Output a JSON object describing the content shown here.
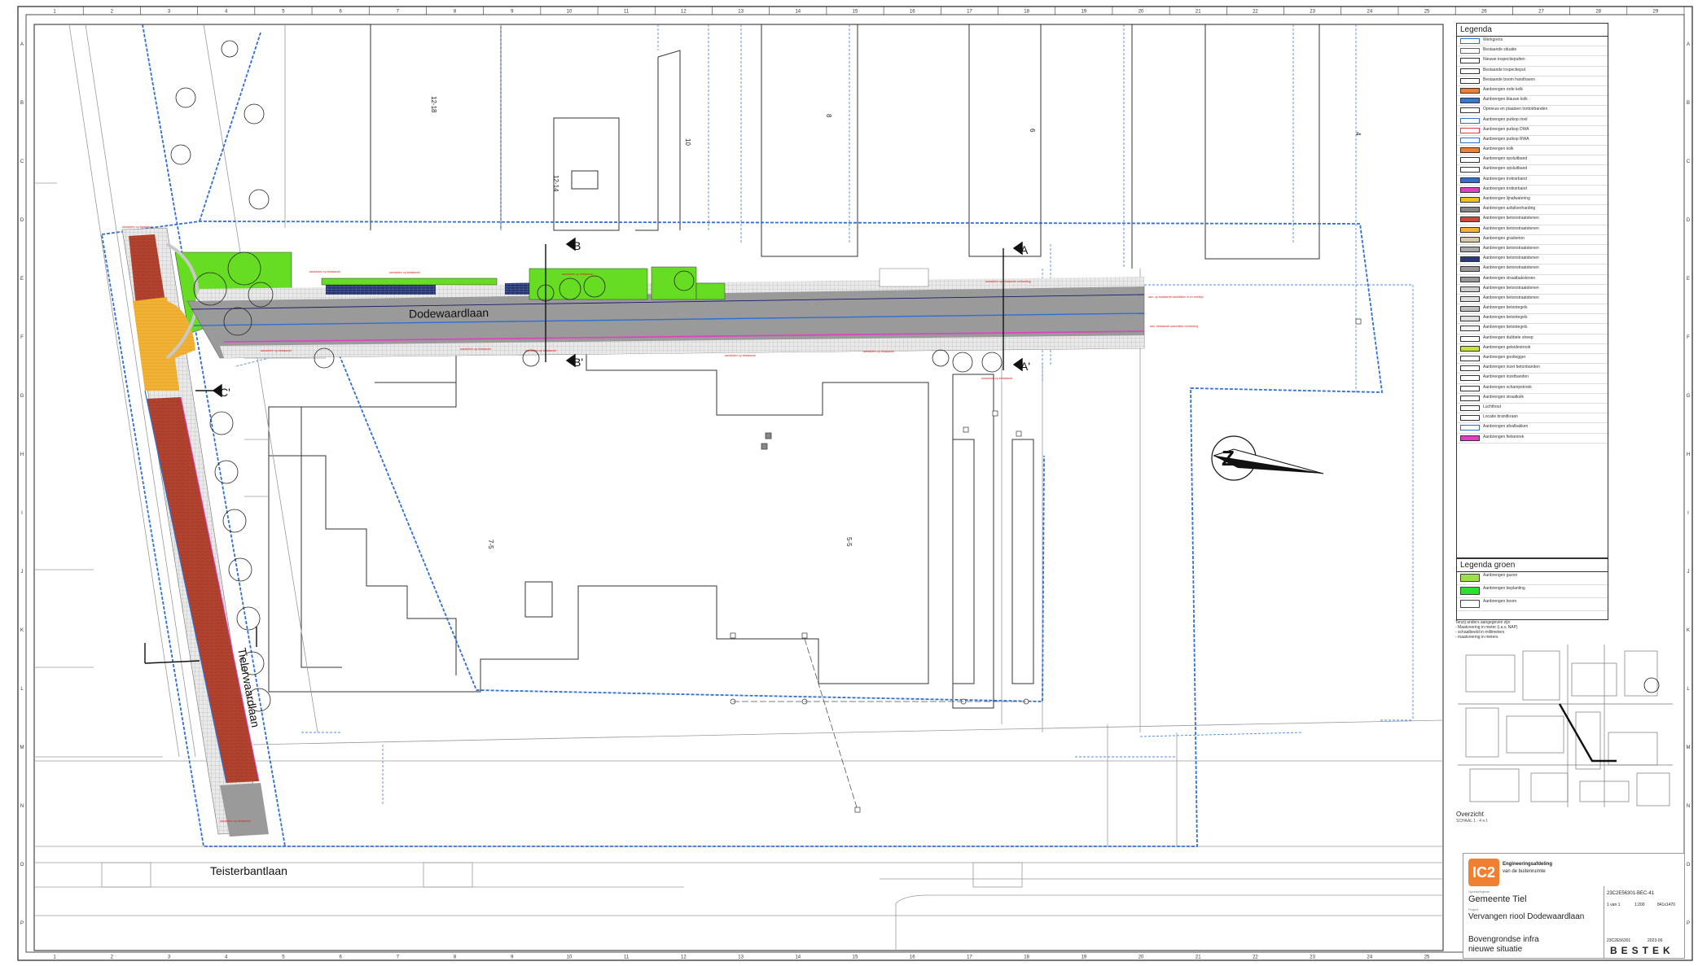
{
  "streets": {
    "dodewaardlaan": "Dodewaardlaan",
    "tielerwaardlaan": "Tielerwaardlaan",
    "teisterbantlaan": "Teisterbantlaan"
  },
  "sections": {
    "a": "A",
    "a_prime": "A'",
    "b": "B",
    "b_prime": "B'",
    "c": "C'"
  },
  "buildings": [
    "12-18",
    "10",
    "12-14",
    "8",
    "6",
    "4",
    "7-5",
    "5-5"
  ],
  "legend": {
    "title": "Legenda",
    "items": [
      {
        "label": "Werkgrens",
        "fill": "#ffffff",
        "stroke": "#2f6fd6"
      },
      {
        "label": "Bestaande situatie",
        "fill": "#ffffff",
        "stroke": "#666666"
      },
      {
        "label": "Nieuwe inspectieputten",
        "fill": "#ffffff",
        "stroke": "#333333"
      },
      {
        "label": "Bestaande inspectieput",
        "fill": "#ffffff",
        "stroke": "#333333"
      },
      {
        "label": "Bestaande boom handhaven",
        "fill": "#ffffff",
        "stroke": "#333333"
      },
      {
        "label": "Aanbrengen rode kolk",
        "fill": "#f08030",
        "stroke": "#333333"
      },
      {
        "label": "Aanbrengen blauwe kolk",
        "fill": "#3a78d8",
        "stroke": "#333333"
      },
      {
        "label": "Opnieuw en plaatsen trottoirbanden",
        "fill": "#ffffff",
        "stroke": "#333333"
      },
      {
        "label": "Aanbrengen putkop riool",
        "fill": "#ffffff",
        "stroke": "#2f6fd6"
      },
      {
        "label": "Aanbrengen putkop DWA",
        "fill": "#ffffff",
        "stroke": "#e04040"
      },
      {
        "label": "Aanbrengen putkop RWA",
        "fill": "#ffffff",
        "stroke": "#2f6fd6"
      },
      {
        "label": "Aanbrengen kolk",
        "fill": "#f08030",
        "stroke": "#333333"
      },
      {
        "label": "Aanbrengen opsluitband",
        "fill": "#ffffff",
        "stroke": "#333333"
      },
      {
        "label": "Aanbrengen opsluitband",
        "fill": "#ffffff",
        "stroke": "#333333"
      },
      {
        "label": "Aanbrengen trottoirband",
        "fill": "#2f6fd6",
        "stroke": "#333333"
      },
      {
        "label": "Aanbrengen trottoirband",
        "fill": "#e040c0",
        "stroke": "#333333"
      },
      {
        "label": "Aanbrengen lijnafwatering",
        "fill": "#f0c020",
        "stroke": "#333333"
      },
      {
        "label": "Aanbrengen asfaltverharding",
        "fill": "#888888",
        "stroke": "#333333"
      },
      {
        "label": "Aanbrengen betonstraatstenen",
        "fill": "#c84a3a",
        "stroke": "#333333"
      },
      {
        "label": "Aanbrengen betonstraatstenen",
        "fill": "#f0b43c",
        "stroke": "#333333"
      },
      {
        "label": "Aanbrengen grasbeton",
        "fill": "#d9c9a8",
        "stroke": "#333333"
      },
      {
        "label": "Aanbrengen betonstraatstenen",
        "fill": "#aaaaaa",
        "stroke": "#333333"
      },
      {
        "label": "Aanbrengen betonstraatstenen",
        "fill": "#2a3a78",
        "stroke": "#333333"
      },
      {
        "label": "Aanbrengen betonstraatstenen",
        "fill": "#999999",
        "stroke": "#333333"
      },
      {
        "label": "Aanbrengen straatbakstenen",
        "fill": "#999999",
        "stroke": "#333333"
      },
      {
        "label": "Aanbrengen betonstraatstenen",
        "fill": "#cccccc",
        "stroke": "#333333"
      },
      {
        "label": "Aanbrengen betonstraatstenen",
        "fill": "#dddddd",
        "stroke": "#333333"
      },
      {
        "label": "Aanbrengen betontegels",
        "fill": "#bbbbbb",
        "stroke": "#333333"
      },
      {
        "label": "Aanbrengen betontegels",
        "fill": "#e0e0e0",
        "stroke": "#333333"
      },
      {
        "label": "Aanbrengen betontegels",
        "fill": "#f4f4f4",
        "stroke": "#333333"
      },
      {
        "label": "Aanbrengen dubbele streep",
        "fill": "#ffffff",
        "stroke": "#333333"
      },
      {
        "label": "Aanbrengen geleidestrook",
        "fill": "#c8e040",
        "stroke": "#333333"
      },
      {
        "label": "Aanbrengen gootlegger",
        "fill": "#ffffff",
        "stroke": "#333333"
      },
      {
        "label": "Aanbrengen inzet betonbanden",
        "fill": "#ffffff",
        "stroke": "#333333"
      },
      {
        "label": "Aanbrengen inzetbanden",
        "fill": "#ffffff",
        "stroke": "#333333"
      },
      {
        "label": "Aanbrengen schampstrook",
        "fill": "#ffffff",
        "stroke": "#333333"
      },
      {
        "label": "Aanbrengen straatkolk",
        "fill": "#ffffff",
        "stroke": "#333333"
      },
      {
        "label": "Luchthout",
        "fill": "#ffffff",
        "stroke": "#333333"
      },
      {
        "label": "Locatie brandkraan",
        "fill": "#ffffff",
        "stroke": "#333333"
      },
      {
        "label": "Aanbrengen afvalbakken",
        "fill": "#ffffff",
        "stroke": "#2f6fd6"
      },
      {
        "label": "Aanbrengen fietsenrek",
        "fill": "#e040c0",
        "stroke": "#333333"
      }
    ]
  },
  "legend_groen": {
    "title": "Legenda groen",
    "items": [
      {
        "label": "Aanbrengen gazon",
        "fill": "#9be04a"
      },
      {
        "label": "Aanbrengen beplanting",
        "fill": "#2ee02e"
      },
      {
        "label": "Aanbrengen boom",
        "fill": "#ffffff"
      }
    ]
  },
  "note": [
    "Tenzij anders aangegeven zijn",
    "- Maatvoering in meter (i.a.v. NAP)",
    "- schaalbeeld in millimeters",
    "- maatvoering in meters"
  ],
  "overview": {
    "label": "Overzicht",
    "scale": "SCHAAL 1 : 4 e.f."
  },
  "titleblock": {
    "company_line1": "Engineeringsafdeling",
    "company_line2": "van de buitenruimte",
    "client_label": "Opdrachtgever",
    "client": "Gemeente Tiel",
    "project_label": "Project",
    "project": "Vervangen riool Dodewaardlaan",
    "drawing_line1": "Bovengrondse infra",
    "drawing_line2": "nieuwe situatie",
    "drawing_number": "23C2E56301-BEC-41",
    "sheet": "1  van 1",
    "scale": "1:200",
    "format": "841x1470",
    "project_number": "23C2E56301",
    "date": "2023-06",
    "status": "BESTEK"
  },
  "ruler_top": [
    "1",
    "2",
    "3",
    "4",
    "5",
    "6",
    "7",
    "8",
    "9",
    "10",
    "11",
    "12",
    "13",
    "14",
    "15",
    "16",
    "17",
    "18",
    "19",
    "20",
    "21",
    "22",
    "23",
    "24",
    "25",
    "26",
    "27",
    "28",
    "29"
  ],
  "ruler_side": [
    "A",
    "B",
    "C",
    "D",
    "E",
    "F",
    "G",
    "H",
    "I",
    "J",
    "K",
    "L",
    "M",
    "N",
    "O",
    "P"
  ],
  "colors": {
    "boundary": "#2f6fd6",
    "asphalt": "#8c8c8c",
    "red_paving": "#b4442f",
    "yellow_paving": "#f2b233",
    "grass": "#66dd22",
    "building_line": "#333333",
    "annotation_red": "#dd2222"
  }
}
